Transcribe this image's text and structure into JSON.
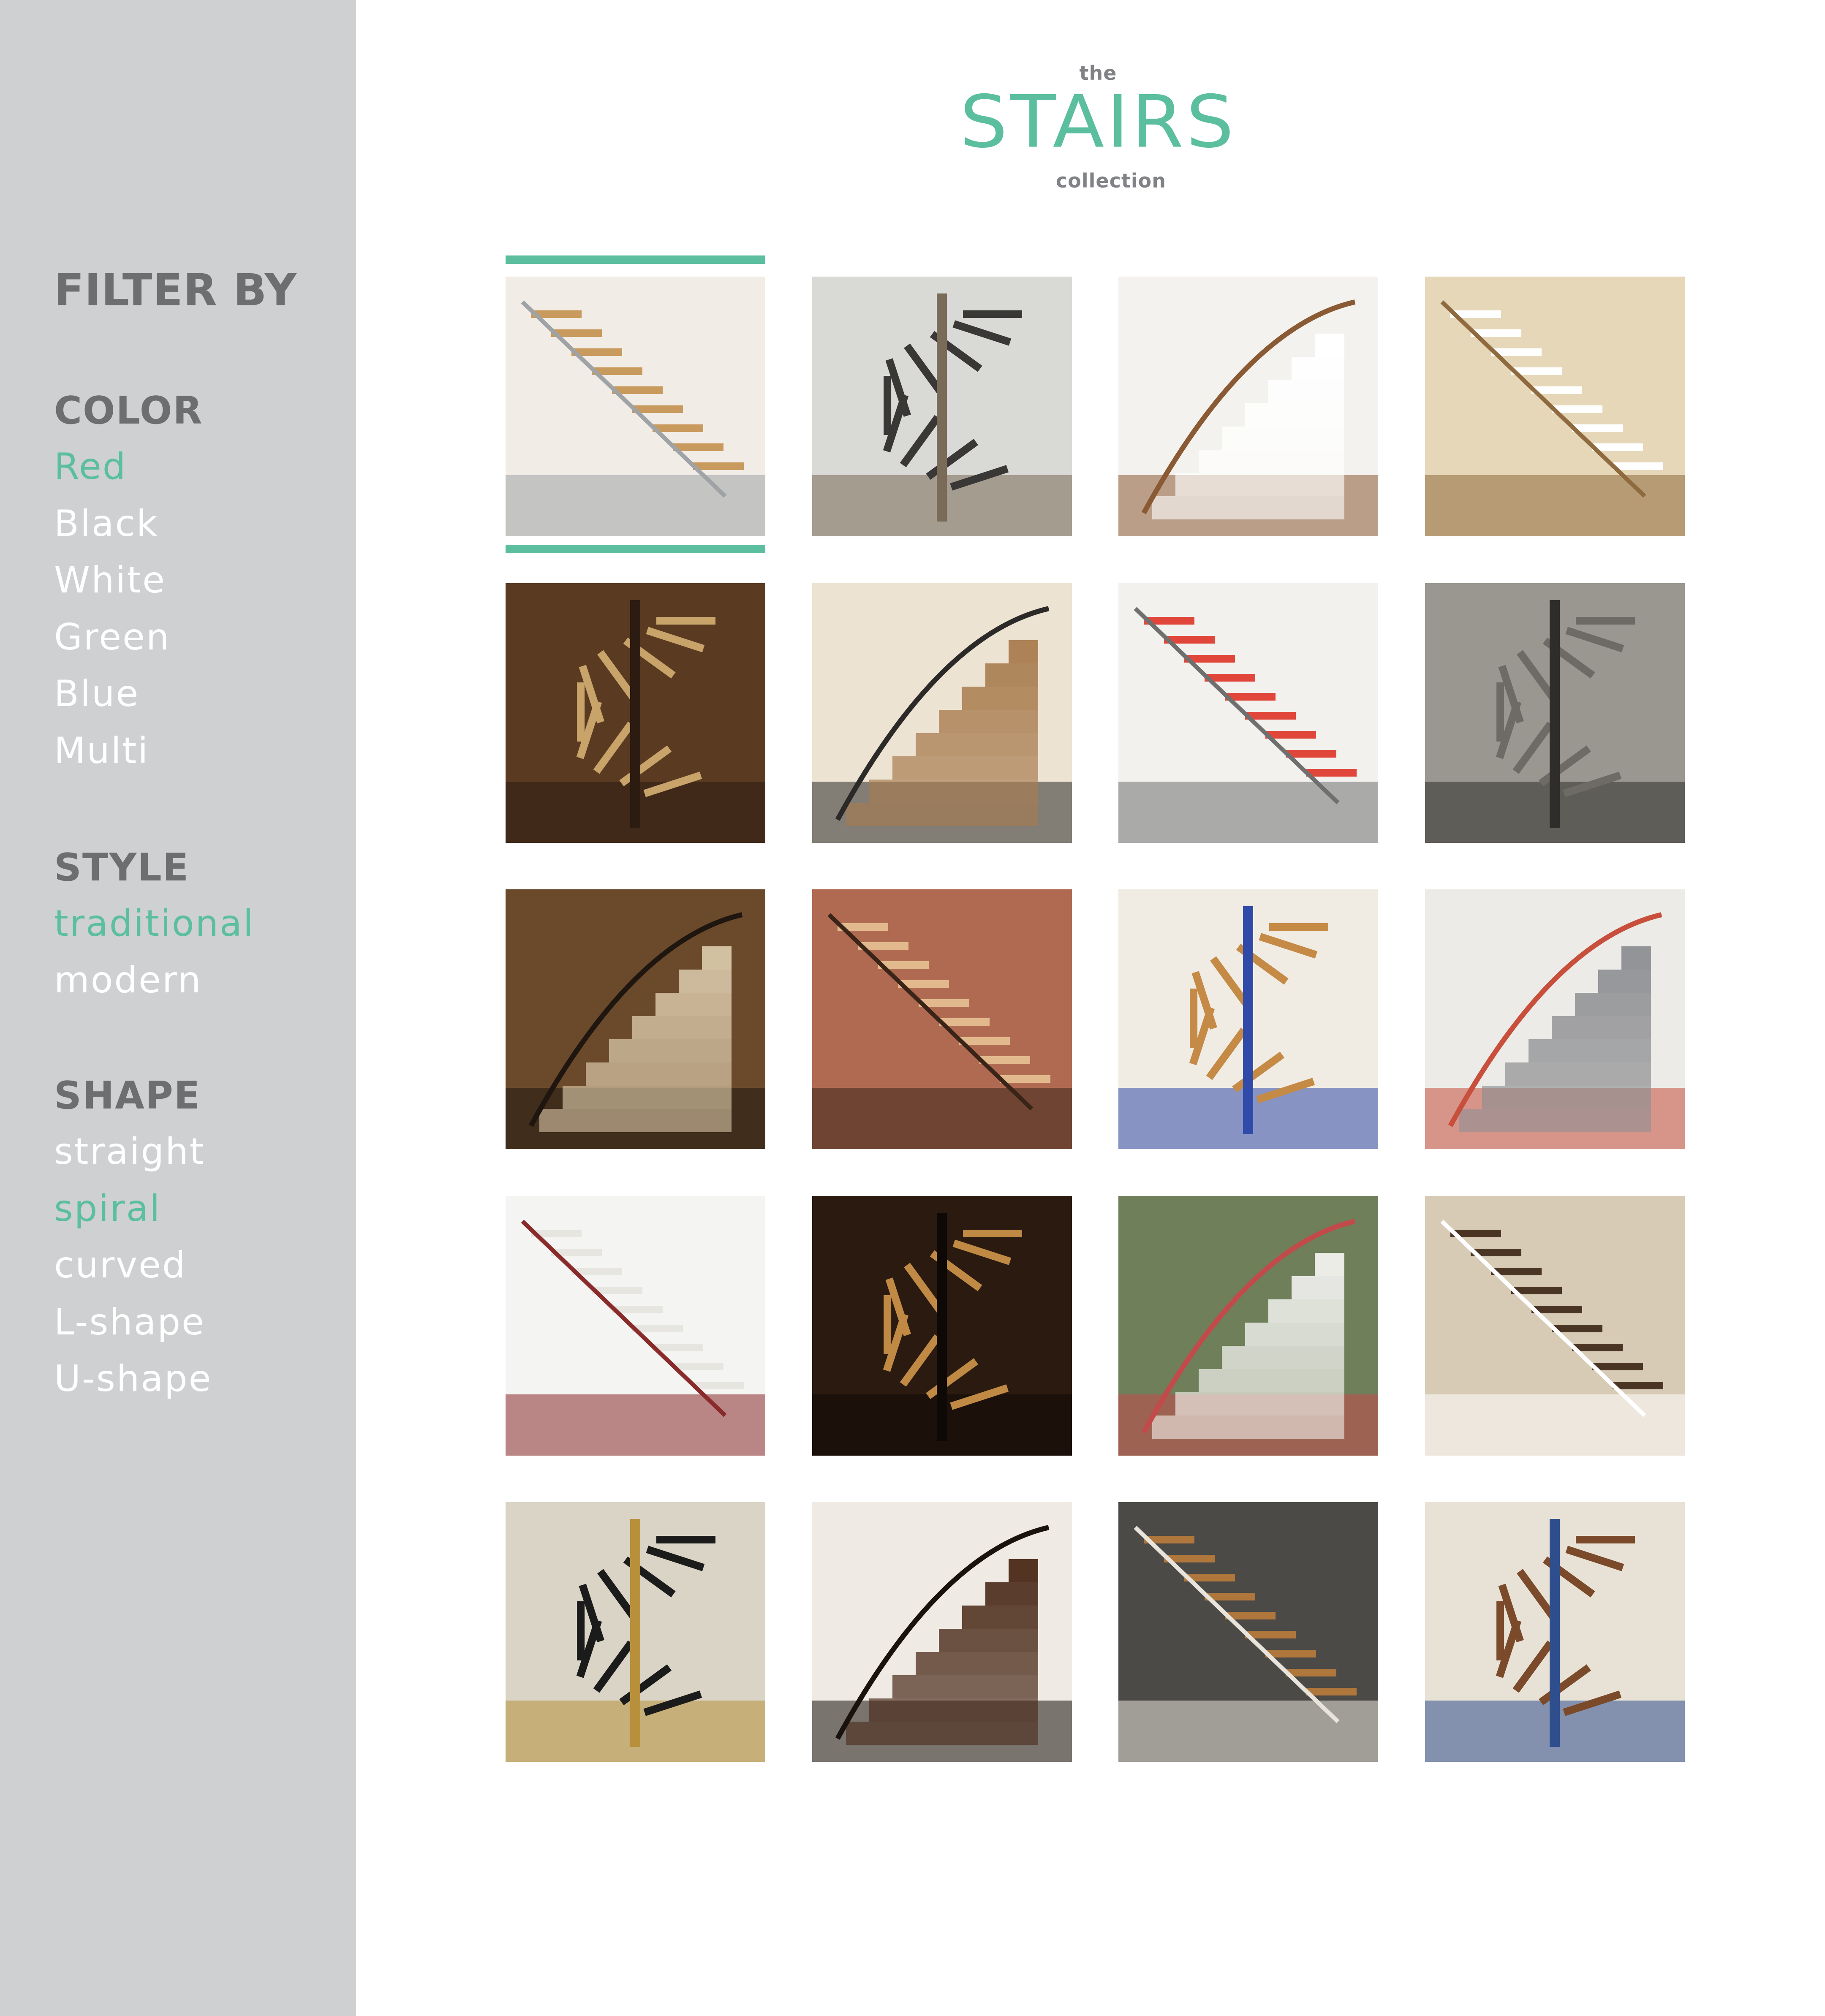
{
  "header": {
    "prefix": "the",
    "title": "STAIRS",
    "suffix": "collection"
  },
  "sidebar": {
    "title": "FILTER BY",
    "groups": [
      {
        "heading": "COLOR",
        "options": [
          {
            "label": "Red",
            "active": true
          },
          {
            "label": "Black",
            "active": false
          },
          {
            "label": "White",
            "active": false
          },
          {
            "label": "Green",
            "active": false
          },
          {
            "label": "Blue",
            "active": false
          },
          {
            "label": "Multi",
            "active": false
          }
        ]
      },
      {
        "heading": "STYLE",
        "options": [
          {
            "label": "traditional",
            "active": true
          },
          {
            "label": "modern",
            "active": false
          }
        ]
      },
      {
        "heading": "SHAPE",
        "options": [
          {
            "label": "straight",
            "active": false
          },
          {
            "label": "spiral",
            "active": true
          },
          {
            "label": "curved",
            "active": false
          },
          {
            "label": "L-shape",
            "active": false
          },
          {
            "label": "U-shape",
            "active": false
          }
        ]
      }
    ]
  },
  "colors": {
    "accent": "#5bbf9f",
    "sidebar_bg": "#cfd0d2",
    "heading_text": "#6d6e70",
    "option_text": "#ffffff"
  },
  "gallery": {
    "selected_index": 0,
    "photos": [
      {
        "name": "photo-stairs-white-compact-wood-treads",
        "palette": [
          "#f1ede6",
          "#c99a5d",
          "#9fa3a6"
        ]
      },
      {
        "name": "photo-stairs-black-steel-with-dog",
        "palette": [
          "#d9d9d6",
          "#3a3836",
          "#7a6a58"
        ]
      },
      {
        "name": "photo-stairs-white-floating-modern",
        "palette": [
          "#f4f2ee",
          "#ffffff",
          "#8a5a34"
        ]
      },
      {
        "name": "photo-stairs-bookshelf-under-stair",
        "palette": [
          "#e6d7b8",
          "#ffffff",
          "#8e6a3e"
        ]
      },
      {
        "name": "photo-stairs-library-ladder-bedroom",
        "palette": [
          "#5a3b22",
          "#c8a36a",
          "#2b1b10"
        ]
      },
      {
        "name": "photo-stairs-spiral-wood-cream-wall",
        "palette": [
          "#ece3d2",
          "#a97c4f",
          "#2c2a28"
        ]
      },
      {
        "name": "photo-stairs-red-spiral-modern",
        "palette": [
          "#f2f1ee",
          "#e0473a",
          "#6f6f6f"
        ]
      },
      {
        "name": "photo-stairs-concrete-narrow",
        "palette": [
          "#9a9791",
          "#6e6b66",
          "#2f2d2a"
        ]
      },
      {
        "name": "photo-stairs-ornate-spiral-library",
        "palette": [
          "#6b4a2c",
          "#d8c7a8",
          "#1f1610"
        ]
      },
      {
        "name": "photo-stairs-wrought-iron-spiral-red-room",
        "palette": [
          "#b06a52",
          "#e2b98d",
          "#3a2418"
        ]
      },
      {
        "name": "photo-stairs-wooden-zigzag-blue",
        "palette": [
          "#f0ece4",
          "#c58a45",
          "#2f4aa8"
        ]
      },
      {
        "name": "photo-stairs-grey-steel-bookcase",
        "palette": [
          "#ecebe8",
          "#8e8f92",
          "#c74f3c"
        ]
      },
      {
        "name": "photo-stairs-white-hallway-rug",
        "palette": [
          "#f4f4f2",
          "#e7e5e0",
          "#8a2b2b"
        ]
      },
      {
        "name": "photo-stairs-dark-victorian-hall",
        "palette": [
          "#2a1a10",
          "#c08a45",
          "#0e0906"
        ]
      },
      {
        "name": "photo-stairs-white-spiral-green-room",
        "palette": [
          "#6f7f5a",
          "#f2f2ef",
          "#c24a4a"
        ]
      },
      {
        "name": "photo-stairs-curved-floating-wood",
        "palette": [
          "#d8cbb5",
          "#4a3424",
          "#ffffff"
        ]
      },
      {
        "name": "photo-stairs-marble-curved-brass-rail",
        "palette": [
          "#d9d4c6",
          "#1b1b1b",
          "#b88f3a"
        ]
      },
      {
        "name": "photo-stairs-dark-spiral-wood-window",
        "palette": [
          "#efebe4",
          "#4a2a18",
          "#1a120c"
        ]
      },
      {
        "name": "photo-stairs-loft-industrial-wood",
        "palette": [
          "#4c4a46",
          "#b0773c",
          "#e8e4dc"
        ]
      },
      {
        "name": "photo-stairs-patterned-tile-risers",
        "palette": [
          "#e8e2d6",
          "#7a4a2a",
          "#2f4e8e"
        ]
      }
    ]
  }
}
